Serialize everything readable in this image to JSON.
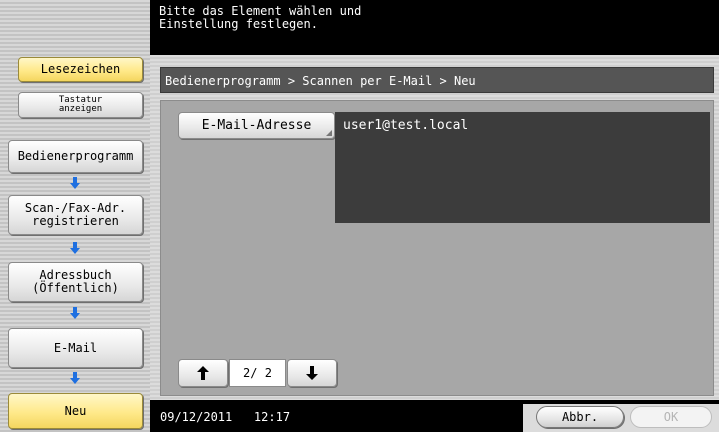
{
  "message": "Bitte das Element wählen und\nEinstellung festlegen.",
  "sidebar": {
    "bookmark_label": "Lesezeichen",
    "keyboard_label": "Tastatur\nanzeigen",
    "steps": [
      "Bedienerprogramm",
      "Scan-/Fax-Adr.\nregistrieren",
      "Adressbuch\n(Öffentlich)",
      "E-Mail",
      "Neu"
    ]
  },
  "breadcrumb": "Bedienerprogramm > Scannen per E-Mail > Neu",
  "email": {
    "button_label": "E-Mail-Adresse",
    "value": "user1@test.local"
  },
  "pager": {
    "display": "2/ 2"
  },
  "footer": {
    "datetime": "09/12/2011   12:17",
    "cancel_label": "Abbr.",
    "ok_label": "OK"
  },
  "colors": {
    "highlight": "#ffe98a",
    "arrow": "#1e6fe0"
  }
}
